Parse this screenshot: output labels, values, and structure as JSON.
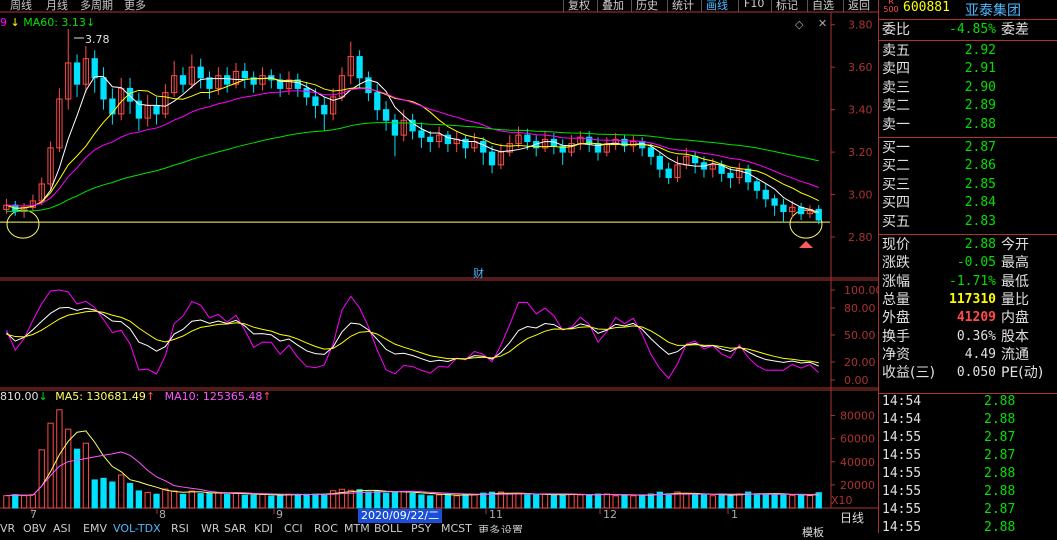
{
  "toolbar": {
    "period_tabs": [
      "周线",
      "月线",
      "多周期",
      "更多"
    ],
    "right_buttons": [
      "复权",
      "叠加",
      "历史",
      "统计",
      "画线",
      "F10",
      "标记",
      "自选",
      "返回"
    ]
  },
  "indicator_ma60": {
    "label": "MA60: 3.13",
    "marker": "9"
  },
  "peak_annotation": "3.78",
  "price_axis": [
    "3.80",
    "3.60",
    "3.40",
    "3.20",
    "3.00",
    "2.80"
  ],
  "osc_axis": [
    "100.00",
    "80.00",
    "50.00",
    "20.00",
    "0.00"
  ],
  "vol_axis": [
    "80000",
    "60000",
    "40000",
    "20000",
    "X10"
  ],
  "vol_legend": {
    "total": "810.00",
    "ma5": "MA5: 130681.49",
    "ma10": "MA10: 125365.48"
  },
  "finance_marker": "财",
  "date_highlight": "2020/09/22/二",
  "month_labels": [
    "7",
    "8",
    "9",
    "11",
    "12",
    "1"
  ],
  "bottom_tabs": [
    "VR",
    "OBV",
    "ASI",
    "EMV",
    "VOL-TDX",
    "RSI",
    "WR",
    "SAR",
    "KDJ",
    "CCI",
    "ROC",
    "MTM",
    "BOLL",
    "PSY",
    "MCST",
    "更多",
    "设置"
  ],
  "daily_label": "日线",
  "bottom_right_btn": "模板",
  "colors": {
    "up": "#ff4b4b",
    "down": "#00e0ff",
    "ma5": "#ffffff",
    "ma10": "#ffff00",
    "ma20": "#ff00ff",
    "ma60": "#00e000",
    "support": "#ffff66",
    "panel_border": "#aa3333"
  },
  "stock": {
    "logo_top": "R",
    "logo_bottom": "500",
    "code": "600881",
    "name": "亚泰集团"
  },
  "order_book": {
    "ratio": {
      "label": "委比",
      "value": "-4.85%",
      "right": "委差"
    },
    "asks": [
      {
        "label": "卖五",
        "price": "2.92"
      },
      {
        "label": "卖四",
        "price": "2.91"
      },
      {
        "label": "卖三",
        "price": "2.90"
      },
      {
        "label": "卖二",
        "price": "2.89"
      },
      {
        "label": "卖一",
        "price": "2.88"
      }
    ],
    "bids": [
      {
        "label": "买一",
        "price": "2.87"
      },
      {
        "label": "买二",
        "price": "2.86"
      },
      {
        "label": "买三",
        "price": "2.85"
      },
      {
        "label": "买四",
        "price": "2.84"
      },
      {
        "label": "买五",
        "price": "2.83"
      }
    ]
  },
  "quote": [
    {
      "label": "现价",
      "value": "2.88",
      "right": "今开",
      "color": "#00e000"
    },
    {
      "label": "涨跌",
      "value": "-0.05",
      "right": "最高",
      "color": "#00e000"
    },
    {
      "label": "涨幅",
      "value": "-1.71%",
      "right": "最低",
      "color": "#00e000"
    },
    {
      "label": "总量",
      "value": "117310",
      "right": "量比",
      "color": "#ffff00"
    },
    {
      "label": "外盘",
      "value": "41209",
      "right": "内盘",
      "color": "#ff4b4b"
    },
    {
      "label": "换手",
      "value": "0.36%",
      "right": "股本",
      "color": "#e0e0e0"
    },
    {
      "label": "净资",
      "value": "4.49",
      "right": "流通",
      "color": "#e0e0e0"
    },
    {
      "label": "收益(三)",
      "value": "0.050",
      "right": "PE(动)",
      "color": "#e0e0e0"
    }
  ],
  "ticks": [
    {
      "time": "14:54",
      "price": "2.88"
    },
    {
      "time": "14:54",
      "price": "2.88"
    },
    {
      "time": "14:55",
      "price": "2.87"
    },
    {
      "time": "14:55",
      "price": "2.87"
    },
    {
      "time": "14:55",
      "price": "2.88"
    },
    {
      "time": "14:55",
      "price": "2.88"
    },
    {
      "time": "14:55",
      "price": "2.87"
    },
    {
      "time": "14:55",
      "price": "2.88"
    }
  ],
  "chart_data": {
    "type": "candlestick",
    "price_range": [
      2.72,
      3.86
    ],
    "support_level": 2.87,
    "peak": 3.78,
    "ma60_last": 3.13,
    "close_last": 2.88,
    "candles": [
      [
        2.93,
        2.95,
        2.98,
        2.91
      ],
      [
        2.95,
        2.92,
        2.97,
        2.9
      ],
      [
        2.92,
        2.94,
        2.96,
        2.89
      ],
      [
        2.94,
        2.97,
        3.0,
        2.92
      ],
      [
        2.97,
        3.05,
        3.08,
        2.95
      ],
      [
        3.05,
        3.22,
        3.25,
        3.02
      ],
      [
        3.22,
        3.45,
        3.5,
        3.2
      ],
      [
        3.45,
        3.62,
        3.78,
        3.4
      ],
      [
        3.62,
        3.52,
        3.66,
        3.46
      ],
      [
        3.52,
        3.64,
        3.7,
        3.48
      ],
      [
        3.64,
        3.55,
        3.68,
        3.48
      ],
      [
        3.55,
        3.45,
        3.6,
        3.4
      ],
      [
        3.45,
        3.38,
        3.5,
        3.33
      ],
      [
        3.38,
        3.5,
        3.55,
        3.35
      ],
      [
        3.5,
        3.44,
        3.55,
        3.38
      ],
      [
        3.44,
        3.36,
        3.48,
        3.3
      ],
      [
        3.36,
        3.42,
        3.47,
        3.32
      ],
      [
        3.42,
        3.38,
        3.46,
        3.33
      ],
      [
        3.38,
        3.48,
        3.52,
        3.36
      ],
      [
        3.48,
        3.56,
        3.63,
        3.46
      ],
      [
        3.56,
        3.52,
        3.6,
        3.48
      ],
      [
        3.52,
        3.6,
        3.66,
        3.5
      ],
      [
        3.6,
        3.55,
        3.64,
        3.5
      ],
      [
        3.55,
        3.5,
        3.58,
        3.45
      ],
      [
        3.5,
        3.56,
        3.6,
        3.47
      ],
      [
        3.56,
        3.52,
        3.6,
        3.48
      ],
      [
        3.52,
        3.58,
        3.62,
        3.5
      ],
      [
        3.58,
        3.55,
        3.62,
        3.5
      ],
      [
        3.55,
        3.52,
        3.58,
        3.48
      ],
      [
        3.52,
        3.56,
        3.6,
        3.49
      ],
      [
        3.56,
        3.54,
        3.59,
        3.5
      ],
      [
        3.54,
        3.5,
        3.57,
        3.46
      ],
      [
        3.5,
        3.54,
        3.58,
        3.47
      ],
      [
        3.54,
        3.5,
        3.57,
        3.46
      ],
      [
        3.5,
        3.46,
        3.53,
        3.42
      ],
      [
        3.46,
        3.42,
        3.5,
        3.36
      ],
      [
        3.42,
        3.38,
        3.46,
        3.3
      ],
      [
        3.38,
        3.46,
        3.5,
        3.35
      ],
      [
        3.46,
        3.56,
        3.6,
        3.44
      ],
      [
        3.56,
        3.65,
        3.72,
        3.52
      ],
      [
        3.65,
        3.55,
        3.68,
        3.5
      ],
      [
        3.55,
        3.48,
        3.58,
        3.44
      ],
      [
        3.48,
        3.4,
        3.52,
        3.35
      ],
      [
        3.4,
        3.35,
        3.44,
        3.3
      ],
      [
        3.35,
        3.28,
        3.38,
        3.18
      ],
      [
        3.28,
        3.35,
        3.4,
        3.25
      ],
      [
        3.35,
        3.3,
        3.38,
        3.26
      ],
      [
        3.3,
        3.27,
        3.34,
        3.22
      ],
      [
        3.27,
        3.25,
        3.3,
        3.2
      ],
      [
        3.25,
        3.28,
        3.32,
        3.22
      ],
      [
        3.28,
        3.24,
        3.3,
        3.2
      ],
      [
        3.24,
        3.26,
        3.3,
        3.2
      ],
      [
        3.26,
        3.22,
        3.28,
        3.17
      ],
      [
        3.22,
        3.25,
        3.29,
        3.2
      ],
      [
        3.25,
        3.2,
        3.27,
        3.14
      ],
      [
        3.2,
        3.14,
        3.23,
        3.1
      ],
      [
        3.14,
        3.2,
        3.24,
        3.12
      ],
      [
        3.2,
        3.24,
        3.28,
        3.18
      ],
      [
        3.24,
        3.28,
        3.32,
        3.22
      ],
      [
        3.28,
        3.25,
        3.31,
        3.21
      ],
      [
        3.25,
        3.22,
        3.28,
        3.18
      ],
      [
        3.22,
        3.26,
        3.3,
        3.2
      ],
      [
        3.26,
        3.23,
        3.29,
        3.19
      ],
      [
        3.23,
        3.2,
        3.26,
        3.14
      ],
      [
        3.2,
        3.24,
        3.28,
        3.18
      ],
      [
        3.24,
        3.27,
        3.3,
        3.21
      ],
      [
        3.27,
        3.24,
        3.3,
        3.2
      ],
      [
        3.24,
        3.2,
        3.27,
        3.16
      ],
      [
        3.2,
        3.24,
        3.27,
        3.18
      ],
      [
        3.24,
        3.26,
        3.29,
        3.21
      ],
      [
        3.26,
        3.23,
        3.28,
        3.2
      ],
      [
        3.23,
        3.25,
        3.28,
        3.2
      ],
      [
        3.25,
        3.22,
        3.27,
        3.18
      ],
      [
        3.22,
        3.18,
        3.24,
        3.14
      ],
      [
        3.18,
        3.12,
        3.2,
        3.08
      ],
      [
        3.12,
        3.08,
        3.15,
        3.05
      ],
      [
        3.08,
        3.14,
        3.18,
        3.06
      ],
      [
        3.14,
        3.18,
        3.22,
        3.12
      ],
      [
        3.18,
        3.15,
        3.2,
        3.1
      ],
      [
        3.15,
        3.12,
        3.18,
        3.08
      ],
      [
        3.12,
        3.14,
        3.17,
        3.08
      ],
      [
        3.14,
        3.1,
        3.16,
        3.06
      ],
      [
        3.1,
        3.08,
        3.13,
        3.03
      ],
      [
        3.08,
        3.12,
        3.15,
        3.05
      ],
      [
        3.12,
        3.06,
        3.14,
        3.02
      ],
      [
        3.06,
        3.02,
        3.08,
        2.98
      ],
      [
        3.02,
        2.98,
        3.05,
        2.94
      ],
      [
        2.98,
        2.95,
        3.0,
        2.9
      ],
      [
        2.95,
        2.92,
        2.98,
        2.87
      ],
      [
        2.92,
        2.94,
        2.97,
        2.89
      ],
      [
        2.94,
        2.91,
        2.96,
        2.88
      ],
      [
        2.91,
        2.93,
        2.95,
        2.89
      ],
      [
        2.93,
        2.88,
        2.95,
        2.86
      ]
    ],
    "oscillator_range": [
      0,
      100
    ],
    "volume_unit_multiplier": 10,
    "volume_range": [
      0,
      90000
    ],
    "volume_ma5_last": 130681.49,
    "volume_ma10_last": 125365.48
  }
}
